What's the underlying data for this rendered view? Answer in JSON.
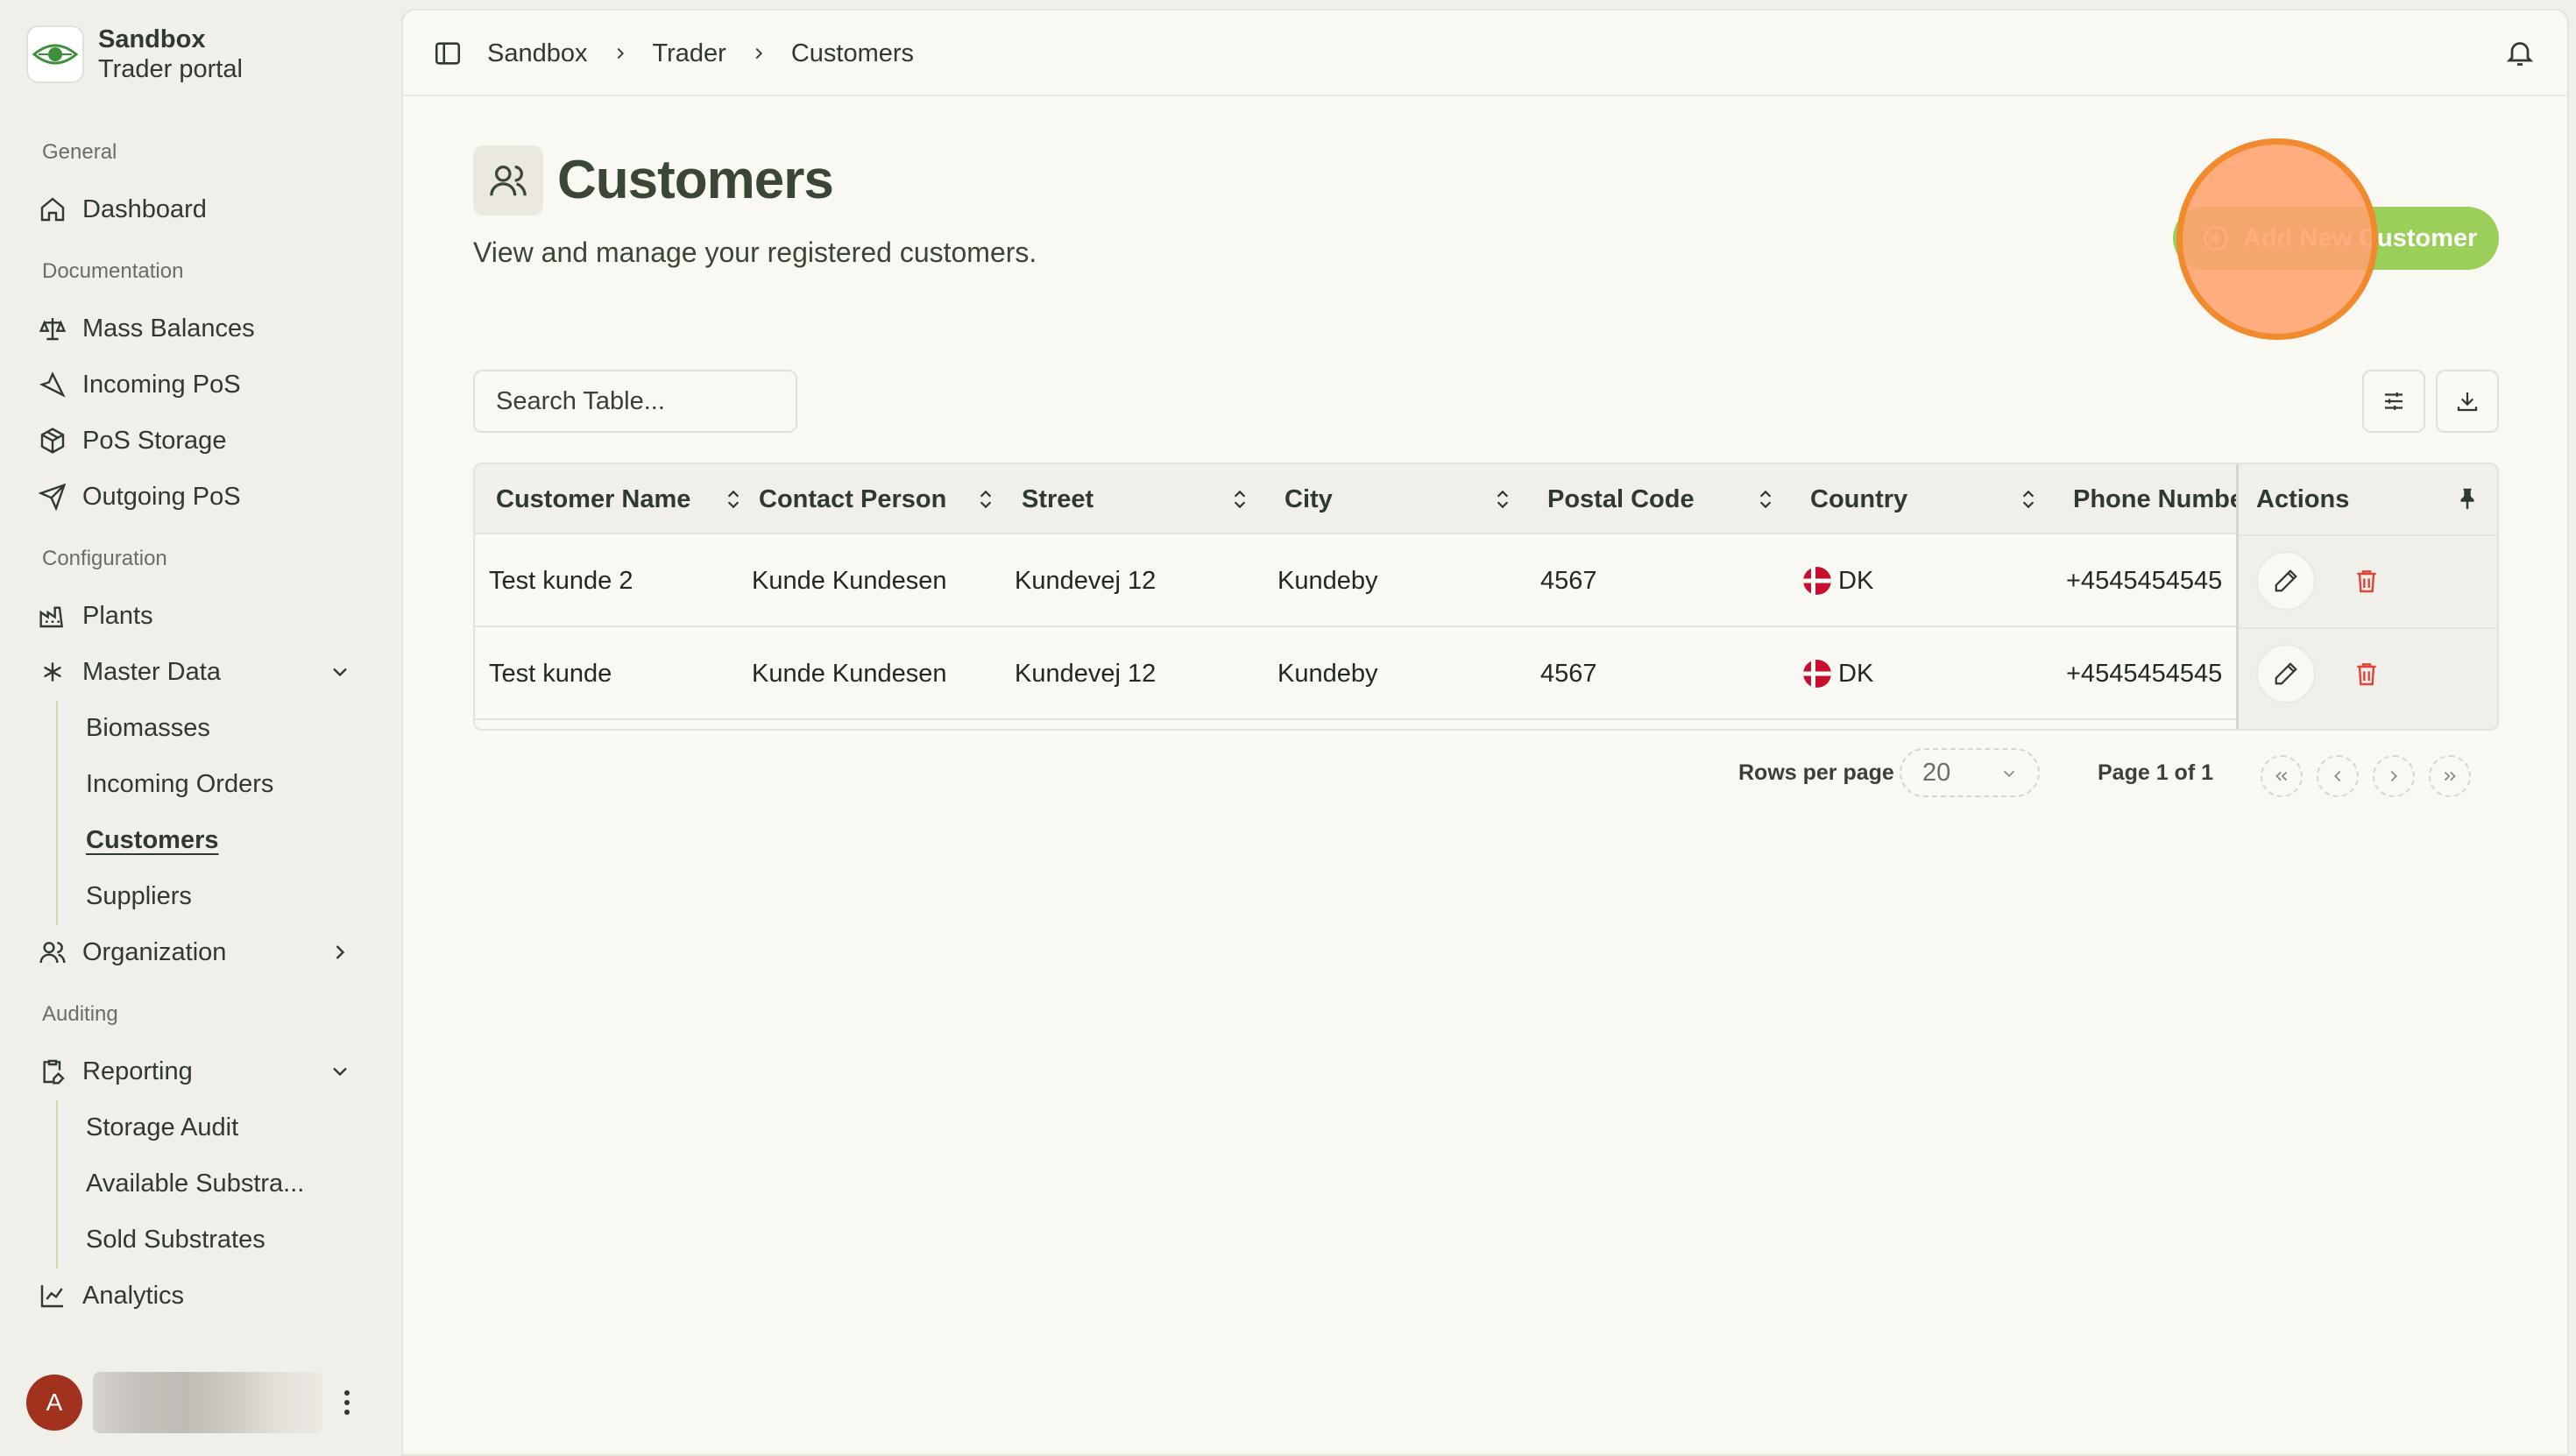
{
  "brand": {
    "title": "Sandbox",
    "subtitle": "Trader portal",
    "logo": "eye-logo-icon"
  },
  "sidebar": {
    "sections": {
      "general": "General",
      "documentation": "Documentation",
      "configuration": "Configuration",
      "auditing": "Auditing"
    },
    "items": {
      "dashboard": "Dashboard",
      "mass_balances": "Mass Balances",
      "incoming_pos": "Incoming PoS",
      "pos_storage": "PoS Storage",
      "outgoing_pos": "Outgoing PoS",
      "plants": "Plants",
      "master_data": "Master Data",
      "organization": "Organization",
      "reporting": "Reporting",
      "analytics": "Analytics"
    },
    "master_data_children": [
      "Biomasses",
      "Incoming Orders",
      "Customers",
      "Suppliers"
    ],
    "reporting_children": [
      "Storage Audit",
      "Available Substra...",
      "Sold Substrates"
    ],
    "active_item": "Customers"
  },
  "user": {
    "initial": "A"
  },
  "breadcrumb": [
    "Sandbox",
    "Trader",
    "Customers"
  ],
  "page": {
    "title": "Customers",
    "subtitle": "View and manage your registered customers.",
    "add_button": "Add New Customer"
  },
  "search": {
    "placeholder": "Search Table..."
  },
  "table": {
    "columns": [
      "Customer Name",
      "Contact Person",
      "Street",
      "City",
      "Postal Code",
      "Country",
      "Phone Numbe",
      "Actions"
    ],
    "rows": [
      {
        "name": "Test kunde 2",
        "contact": "Kunde Kundesen",
        "street": "Kundevej 12",
        "city": "Kundeby",
        "postal": "4567",
        "country": "DK",
        "phone": "+4545454545"
      },
      {
        "name": "Test kunde",
        "contact": "Kunde Kundesen",
        "street": "Kundevej 12",
        "city": "Kundeby",
        "postal": "4567",
        "country": "DK",
        "phone": "+4545454545"
      }
    ]
  },
  "pagination": {
    "rows_label": "Rows per page",
    "rows_value": "20",
    "page_info": "Page 1 of 1"
  },
  "colors": {
    "accent": "#9ad05a",
    "danger": "#e0443a",
    "click_marker": "#f08a2c",
    "avatar": "#a2311d"
  }
}
